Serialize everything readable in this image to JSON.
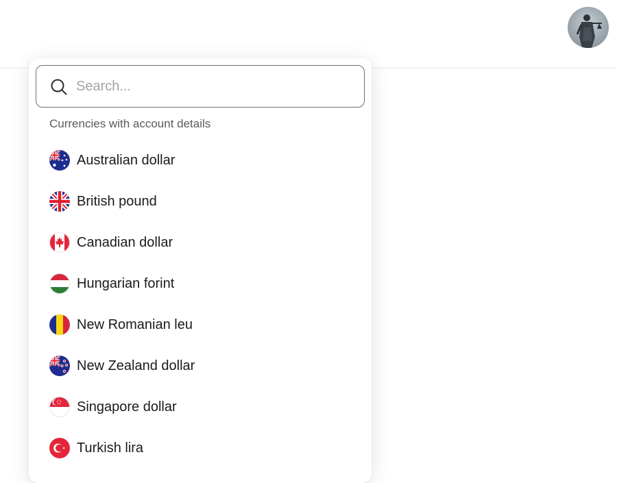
{
  "header": {
    "avatar_icon": "user-avatar"
  },
  "currency_picker": {
    "search": {
      "placeholder": "Search...",
      "value": ""
    },
    "section_label": "Currencies with account details",
    "items": [
      {
        "label": "Australian dollar",
        "flag": "au-flag"
      },
      {
        "label": "British pound",
        "flag": "gb-flag"
      },
      {
        "label": "Canadian dollar",
        "flag": "ca-flag"
      },
      {
        "label": "Hungarian forint",
        "flag": "hu-flag"
      },
      {
        "label": "New Romanian leu",
        "flag": "ro-flag"
      },
      {
        "label": "New Zealand dollar",
        "flag": "nz-flag"
      },
      {
        "label": "Singapore dollar",
        "flag": "sg-flag"
      },
      {
        "label": "Turkish lira",
        "flag": "tr-flag"
      }
    ]
  },
  "colors": {
    "search_border": "#6f6f6f",
    "placeholder": "#a3a3a3",
    "section_label": "#5a5a5a",
    "item_text": "#1a1a1a"
  }
}
